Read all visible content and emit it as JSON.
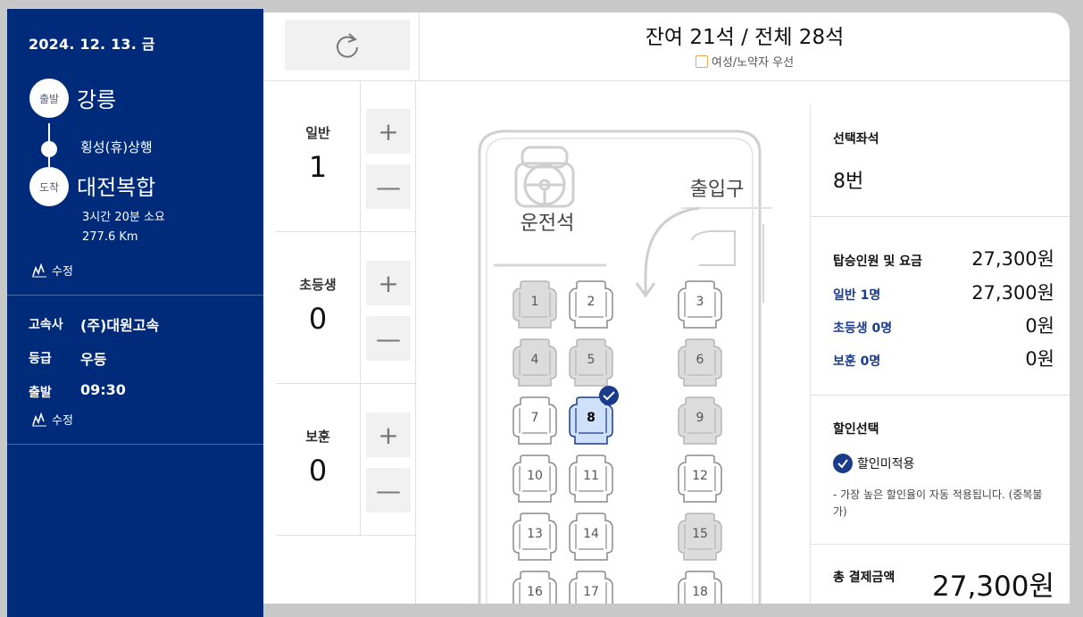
{
  "trip": {
    "date": "2024. 12. 13. 금",
    "depart_badge": "출발",
    "depart_city": "강릉",
    "via": "횡성(휴)상행",
    "arrive_badge": "도착",
    "arrive_city": "대전복합",
    "duration": "3시간 20분 소요",
    "distance": "277.6 Km",
    "edit_label": "수정"
  },
  "bus_info": {
    "company_label": "고속사",
    "company": "(주)대원고속",
    "grade_label": "등급",
    "grade": "우등",
    "depart_label": "출발",
    "depart_time": "09:30",
    "edit_label": "수정"
  },
  "header": {
    "seat_count": "잔여 21석 / 전체 28석",
    "priority_legend": "여성/노약자 우선"
  },
  "passengers": [
    {
      "label": "일반",
      "count": "1"
    },
    {
      "label": "초등생",
      "count": "0"
    },
    {
      "label": "보훈",
      "count": "0"
    }
  ],
  "buttons": {
    "plus": "+",
    "minus": "—"
  },
  "bus_map": {
    "driver_label": "운전석",
    "entrance_label": "출입구",
    "selected_seat": 8,
    "seats": [
      {
        "num": 1,
        "status": "occupied"
      },
      {
        "num": 2,
        "status": "available"
      },
      {
        "num": 3,
        "status": "available"
      },
      {
        "num": 4,
        "status": "occupied"
      },
      {
        "num": 5,
        "status": "occupied"
      },
      {
        "num": 6,
        "status": "occupied"
      },
      {
        "num": 7,
        "status": "available"
      },
      {
        "num": 8,
        "status": "selected"
      },
      {
        "num": 9,
        "status": "occupied"
      },
      {
        "num": 10,
        "status": "available"
      },
      {
        "num": 11,
        "status": "available"
      },
      {
        "num": 12,
        "status": "available"
      },
      {
        "num": 13,
        "status": "available"
      },
      {
        "num": 14,
        "status": "available"
      },
      {
        "num": 15,
        "status": "occupied"
      },
      {
        "num": 16,
        "status": "available"
      },
      {
        "num": 17,
        "status": "available"
      },
      {
        "num": 18,
        "status": "available"
      }
    ]
  },
  "summary": {
    "selected_title": "선택좌석",
    "selected_value": "8번",
    "fare_label": "탑승인원 및 요금",
    "fare_total": "27,300원",
    "general_label": "일반 1명",
    "general_fare": "27,300원",
    "child_label": "초등생 0명",
    "child_fare": "0원",
    "veteran_label": "보훈 0명",
    "veteran_fare": "0원",
    "discount_title": "할인선택",
    "discount_option": "할인미적용",
    "discount_note": "- 가장 높은 할인율이 자동 적용됩니다. (중복불가)",
    "total_label": "총 결제금액",
    "total_value": "27,300원"
  },
  "colors": {
    "navy": "#002b7a",
    "accent_blue": "#1a3a8a",
    "selected_seat": "#cfe0fb",
    "occupied_seat": "#dcdcdc",
    "priority_border": "#e8a94a"
  }
}
